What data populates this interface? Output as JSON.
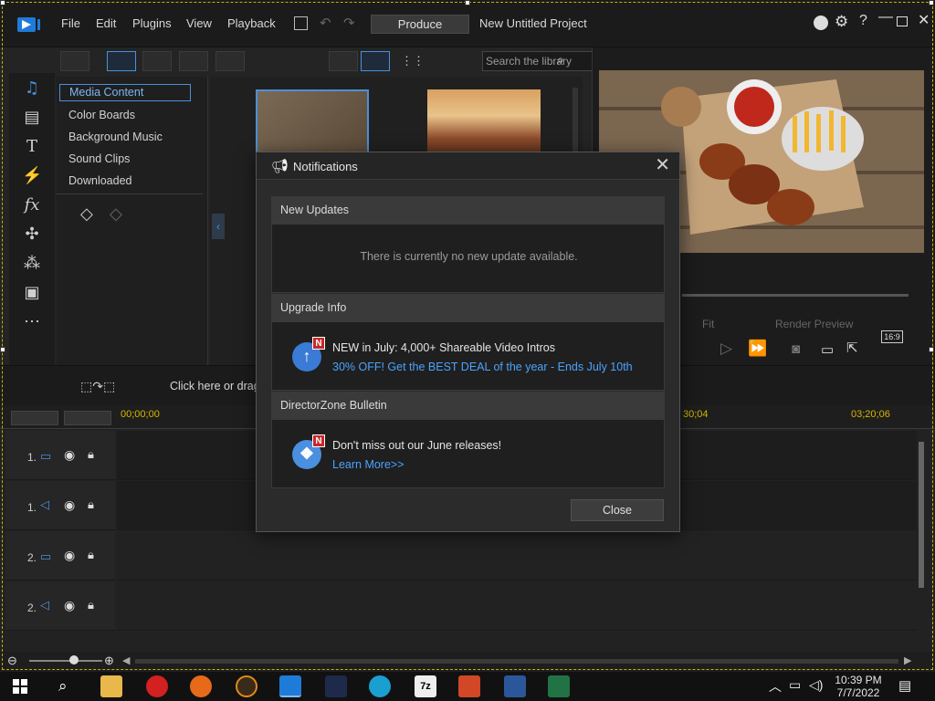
{
  "menubar": {
    "items": [
      "File",
      "Edit",
      "Plugins",
      "View",
      "Playback"
    ],
    "produce_label": "Produce",
    "project_title": "New Untitled Project"
  },
  "library": {
    "search_placeholder": "Search the library",
    "categories": [
      {
        "label": "Media Content",
        "active": true
      },
      {
        "label": "Color Boards",
        "active": false
      },
      {
        "label": "Background Music",
        "active": false
      },
      {
        "label": "Sound Clips",
        "active": false
      },
      {
        "label": "Downloaded",
        "active": false
      }
    ]
  },
  "preview": {
    "fit_label": "Fit",
    "render_preview_label": "Render Preview",
    "aspect_label": "16:9"
  },
  "timeline": {
    "drop_hint": "Click here or drag",
    "ruler_marks": [
      "00;00;00",
      "30;04",
      "03;20;06"
    ],
    "tracks": [
      {
        "num": "1.",
        "kind": "video"
      },
      {
        "num": "1.",
        "kind": "audio"
      },
      {
        "num": "2.",
        "kind": "video"
      },
      {
        "num": "2.",
        "kind": "audio"
      }
    ]
  },
  "notifications": {
    "title": "Notifications",
    "sections": {
      "new_updates": {
        "header": "New Updates",
        "message": "There is currently no new update available."
      },
      "upgrade_info": {
        "header": "Upgrade Info",
        "badge": "N",
        "title": "NEW in July: 4,000+ Shareable Video Intros",
        "link": "30% OFF! Get the BEST DEAL of the year - Ends July 10th"
      },
      "bulletin": {
        "header": "DirectorZone Bulletin",
        "badge": "N",
        "title": "Don't miss out our June releases!",
        "link": "Learn More>>"
      }
    },
    "close_label": "Close"
  },
  "taskbar": {
    "time": "10:39 PM",
    "date": "7/7/2022",
    "icons": [
      "start-icon",
      "search-icon",
      "file-explorer-icon",
      "power-app-icon",
      "firefox-icon",
      "media-app-icon",
      "powerdirector-icon",
      "video-app-icon",
      "edge-icon",
      "7zip-icon",
      "powerpoint-icon",
      "word-icon",
      "excel-icon"
    ]
  },
  "colors": {
    "accent": "#4a90d9",
    "link": "#4aa3ff",
    "badge": "#c62828"
  }
}
